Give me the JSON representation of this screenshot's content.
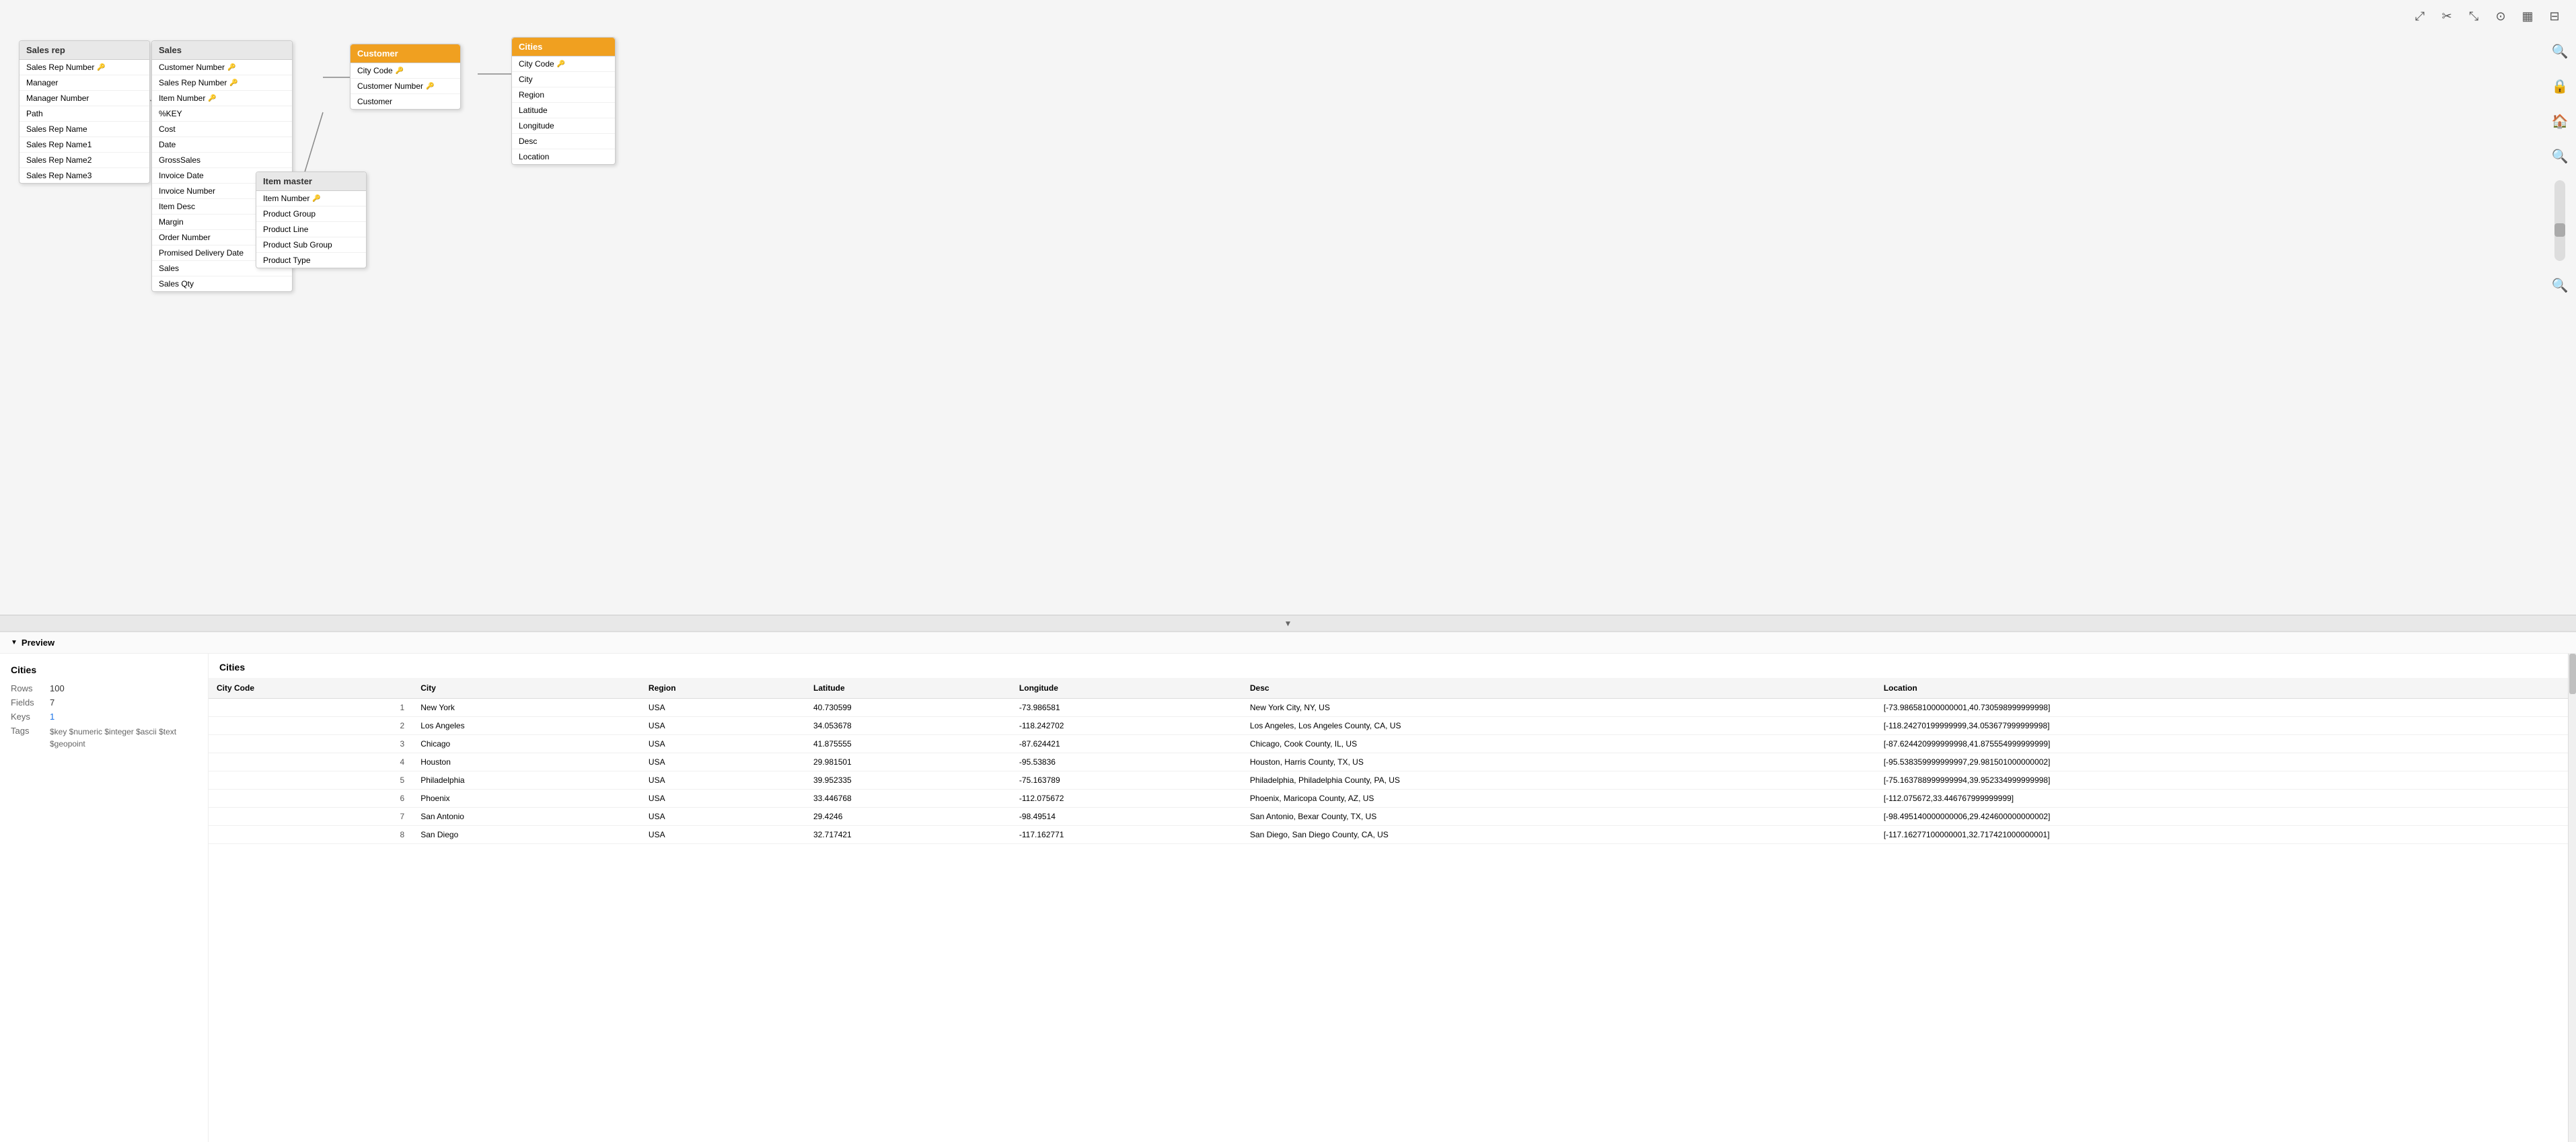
{
  "toolbar": {
    "icons": [
      {
        "name": "fit-icon",
        "symbol": "⤢"
      },
      {
        "name": "cut-icon",
        "symbol": "✂"
      },
      {
        "name": "expand-icon",
        "symbol": "⤡"
      },
      {
        "name": "dots-icon",
        "symbol": "⊞"
      },
      {
        "name": "grid-icon",
        "symbol": "▦"
      },
      {
        "name": "layout-icon",
        "symbol": "⊟"
      }
    ]
  },
  "sidebar_right": {
    "icons": [
      {
        "name": "search-icon",
        "symbol": "🔍"
      },
      {
        "name": "lock-icon",
        "symbol": "🔒"
      },
      {
        "name": "home-icon",
        "symbol": "🏠"
      },
      {
        "name": "zoom-out-top-icon",
        "symbol": "🔍"
      },
      {
        "name": "zoom-in-icon",
        "symbol": "🔍"
      },
      {
        "name": "zoom-out-icon",
        "symbol": "🔍"
      }
    ]
  },
  "tables": {
    "sales_rep": {
      "title": "Sales rep",
      "header_style": "gray",
      "fields": [
        {
          "name": "Sales Rep Number",
          "is_key": true
        },
        {
          "name": "Manager",
          "is_key": false
        },
        {
          "name": "Manager Number",
          "is_key": false
        },
        {
          "name": "Path",
          "is_key": false
        },
        {
          "name": "Sales Rep Name",
          "is_key": false
        },
        {
          "name": "Sales Rep Name1",
          "is_key": false
        },
        {
          "name": "Sales Rep Name2",
          "is_key": false
        },
        {
          "name": "Sales Rep Name3",
          "is_key": false
        }
      ]
    },
    "sales": {
      "title": "Sales",
      "header_style": "gray",
      "fields": [
        {
          "name": "Customer Number",
          "is_key": true
        },
        {
          "name": "Sales Rep Number",
          "is_key": true
        },
        {
          "name": "Item Number",
          "is_key": true
        },
        {
          "name": "%KEY",
          "is_key": false
        },
        {
          "name": "Cost",
          "is_key": false
        },
        {
          "name": "Date",
          "is_key": false
        },
        {
          "name": "GrossSales",
          "is_key": false
        },
        {
          "name": "Invoice Date",
          "is_key": false
        },
        {
          "name": "Invoice Number",
          "is_key": false
        },
        {
          "name": "Item Desc",
          "is_key": false
        },
        {
          "name": "Margin",
          "is_key": false
        },
        {
          "name": "Order Number",
          "is_key": false
        },
        {
          "name": "Promised Delivery Date",
          "is_key": false
        },
        {
          "name": "Sales",
          "is_key": false
        },
        {
          "name": "Sales Qty",
          "is_key": false
        }
      ]
    },
    "customer": {
      "title": "Customer",
      "header_style": "orange",
      "fields": [
        {
          "name": "City Code",
          "is_key": true
        },
        {
          "name": "Customer Number",
          "is_key": true
        },
        {
          "name": "Customer",
          "is_key": false
        }
      ]
    },
    "item_master": {
      "title": "Item master",
      "header_style": "gray",
      "fields": [
        {
          "name": "Item Number",
          "is_key": true
        },
        {
          "name": "Product Group",
          "is_key": false
        },
        {
          "name": "Product Line",
          "is_key": false
        },
        {
          "name": "Product Sub Group",
          "is_key": false
        },
        {
          "name": "Product Type",
          "is_key": false
        }
      ]
    },
    "cities": {
      "title": "Cities",
      "header_style": "orange",
      "fields": [
        {
          "name": "City Code",
          "is_key": true
        },
        {
          "name": "City",
          "is_key": false
        },
        {
          "name": "Region",
          "is_key": false
        },
        {
          "name": "Latitude",
          "is_key": false
        },
        {
          "name": "Longitude",
          "is_key": false
        },
        {
          "name": "Desc",
          "is_key": false
        },
        {
          "name": "Location",
          "is_key": false
        }
      ]
    }
  },
  "preview": {
    "header": "Preview",
    "left_title": "Cities",
    "rows": "100",
    "fields": "7",
    "keys": "1",
    "tags": "$key $numeric $integer $ascii $text $geopoint",
    "right_title": "Cities",
    "columns": [
      "City Code",
      "City",
      "Region",
      "Latitude",
      "Longitude",
      "Desc",
      "Location"
    ],
    "data": [
      {
        "city_code": "1",
        "city": "New York",
        "region": "USA",
        "latitude": "40.730599",
        "longitude": "-73.986581",
        "desc": "New York City, NY, US",
        "location": "[-73.986581000000001,40.730598999999998]"
      },
      {
        "city_code": "2",
        "city": "Los Angeles",
        "region": "USA",
        "latitude": "34.053678",
        "longitude": "-118.242702",
        "desc": "Los Angeles, Los Angeles County, CA, US",
        "location": "[-118.24270199999999,34.053677999999998]"
      },
      {
        "city_code": "3",
        "city": "Chicago",
        "region": "USA",
        "latitude": "41.875555",
        "longitude": "-87.624421",
        "desc": "Chicago, Cook County, IL, US",
        "location": "[-87.624420999999998,41.875554999999999]"
      },
      {
        "city_code": "4",
        "city": "Houston",
        "region": "USA",
        "latitude": "29.981501",
        "longitude": "-95.53836",
        "desc": "Houston, Harris County, TX, US",
        "location": "[-95.538359999999997,29.981501000000002]"
      },
      {
        "city_code": "5",
        "city": "Philadelphia",
        "region": "USA",
        "latitude": "39.952335",
        "longitude": "-75.163789",
        "desc": "Philadelphia, Philadelphia County, PA, US",
        "location": "[-75.163788999999994,39.952334999999998]"
      },
      {
        "city_code": "6",
        "city": "Phoenix",
        "region": "USA",
        "latitude": "33.446768",
        "longitude": "-112.075672",
        "desc": "Phoenix, Maricopa County, AZ, US",
        "location": "[-112.075672,33.446767999999999]"
      },
      {
        "city_code": "7",
        "city": "San Antonio",
        "region": "USA",
        "latitude": "29.4246",
        "longitude": "-98.49514",
        "desc": "San Antonio, Bexar County, TX, US",
        "location": "[-98.495140000000006,29.424600000000002]"
      },
      {
        "city_code": "8",
        "city": "San Diego",
        "region": "USA",
        "latitude": "32.717421",
        "longitude": "-117.162771",
        "desc": "San Diego, San Diego County, CA, US",
        "location": "[-117.16277100000001,32.717421000000001]"
      }
    ]
  }
}
